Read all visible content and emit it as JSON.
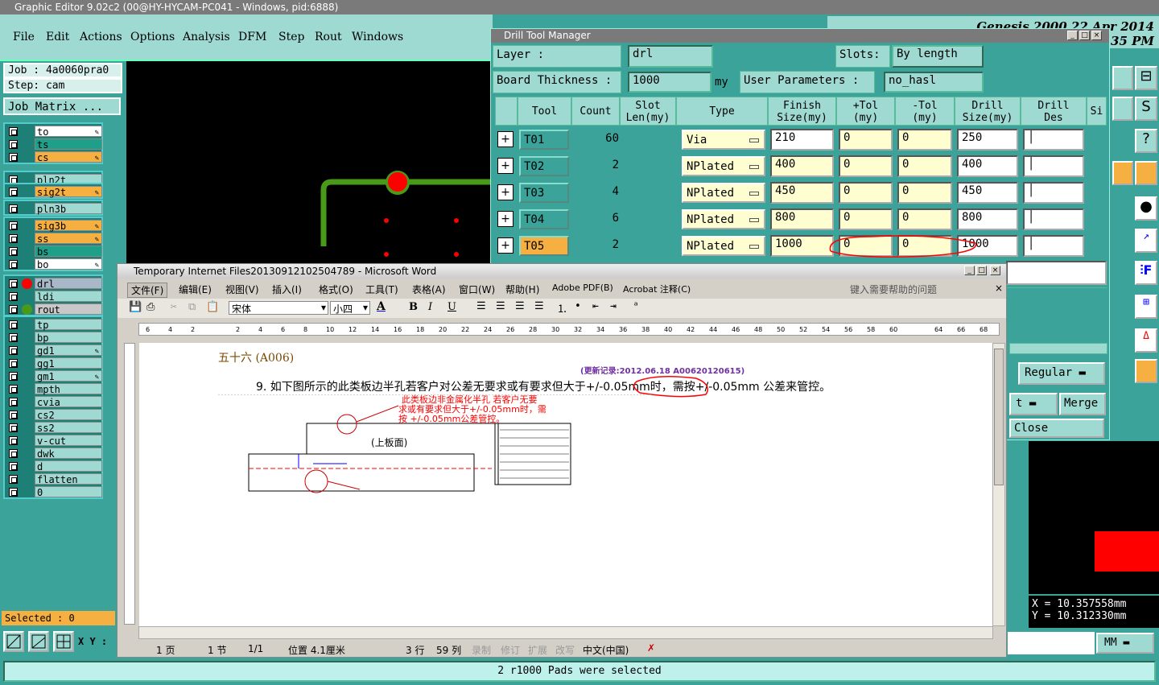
{
  "main_window": {
    "title": "Graphic Editor 9.02c2 (00@HY-HYCAM-PC041 - Windows, pid:6888)",
    "menu": [
      "File",
      "Edit",
      "Actions",
      "Options",
      "Analysis",
      "DFM",
      "Step",
      "Rout",
      "Windows"
    ],
    "right_title": "Genesis 2000 22 Apr 2014",
    "right_time": "35 PM"
  },
  "left_panel": {
    "job": "Job : 4a0060pra0",
    "step": "Step: cam",
    "job_matrix": "Job Matrix ...",
    "groups": [
      [
        {
          "n": "to",
          "c": "#ffffff",
          "m": "✎"
        },
        {
          "n": "ts",
          "c": "#1e9f8a",
          "m": ""
        },
        {
          "n": "cs",
          "c": "#f5b041",
          "m": "✎"
        }
      ],
      [
        {
          "n": "pln2t",
          "c": "#9ed9d2",
          "m": ""
        }
      ],
      [
        {
          "n": "sig2t",
          "c": "#f5b041",
          "m": "✎"
        }
      ],
      [
        {
          "n": "pln3b",
          "c": "#9ed9d2",
          "m": ""
        }
      ],
      [
        {
          "n": "sig3b",
          "c": "#f5b041",
          "m": "✎"
        },
        {
          "n": "ss",
          "c": "#f5b041",
          "m": "✎"
        },
        {
          "n": "bs",
          "c": "#1e9f8a",
          "m": ""
        },
        {
          "n": "bo",
          "c": "#ffffff",
          "m": "✎"
        }
      ],
      [
        {
          "n": "drl",
          "c": "#a8b8c8",
          "m": ""
        },
        {
          "n": "ldi",
          "c": "#9ed9d2",
          "m": ""
        },
        {
          "n": "rout",
          "c": "#c8c8c8",
          "m": ""
        }
      ],
      [
        {
          "n": "tp",
          "c": "#9ed9d2",
          "m": ""
        },
        {
          "n": "bp",
          "c": "#9ed9d2",
          "m": ""
        },
        {
          "n": "gd1",
          "c": "#9ed9d2",
          "m": "✎"
        },
        {
          "n": "gg1",
          "c": "#9ed9d2",
          "m": ""
        },
        {
          "n": "gm1",
          "c": "#9ed9d2",
          "m": "✎"
        },
        {
          "n": "mpth",
          "c": "#9ed9d2",
          "m": ""
        },
        {
          "n": "cvia",
          "c": "#9ed9d2",
          "m": ""
        },
        {
          "n": "cs2",
          "c": "#9ed9d2",
          "m": ""
        },
        {
          "n": "ss2",
          "c": "#9ed9d2",
          "m": ""
        },
        {
          "n": "v-cut",
          "c": "#9ed9d2",
          "m": ""
        },
        {
          "n": "dwk",
          "c": "#9ed9d2",
          "m": ""
        },
        {
          "n": "d",
          "c": "#9ed9d2",
          "m": ""
        },
        {
          "n": "flatten",
          "c": "#9ed9d2",
          "m": ""
        },
        {
          "n": "0",
          "c": "#9ed9d2",
          "m": ""
        }
      ]
    ],
    "selected": "Selected : 0",
    "xy_label": "X Y :"
  },
  "drill_tool_manager": {
    "title": "Drill Tool Manager",
    "layer_label": "Layer       :",
    "layer_value": "drl",
    "slots_label": "Slots:",
    "slots_value": "By length",
    "thickness_label": "Board Thickness  :",
    "thickness_value": "1000",
    "thickness_unit": "my",
    "user_params_label": "User Parameters :",
    "user_params_value": "no_hasl",
    "headers": [
      "Tool",
      "Count",
      "Slot\nLen(my)",
      "Type",
      "Finish\nSize(my)",
      "+Tol\n(my)",
      "-Tol\n(my)",
      "Drill\nSize(my)",
      "Drill\nDes",
      "Si"
    ],
    "rows": [
      {
        "tool": "T01",
        "count": "60",
        "type": "Via",
        "finish": "210",
        "ptol": "0",
        "ntol": "0",
        "drill": "250",
        "des": ""
      },
      {
        "tool": "T02",
        "count": "2",
        "type": "NPlated",
        "finish": "400",
        "ptol": "0",
        "ntol": "0",
        "drill": "400",
        "des": ""
      },
      {
        "tool": "T03",
        "count": "4",
        "type": "NPlated",
        "finish": "450",
        "ptol": "0",
        "ntol": "0",
        "drill": "450",
        "des": ""
      },
      {
        "tool": "T04",
        "count": "6",
        "type": "NPlated",
        "finish": "800",
        "ptol": "0",
        "ntol": "0",
        "drill": "800",
        "des": ""
      },
      {
        "tool": "T05",
        "count": "2",
        "type": "NPlated",
        "finish": "1000",
        "ptol": "0",
        "ntol": "0",
        "drill": "1000",
        "des": ""
      }
    ],
    "regular": "Regular",
    "merge": "Merge",
    "close": "Close"
  },
  "word": {
    "title": "Temporary Internet Files20130912102504789 - Microsoft Word",
    "menu": [
      "文件(F)",
      "编辑(E)",
      "视图(V)",
      "插入(I)",
      "格式(O)",
      "工具(T)",
      "表格(A)",
      "窗口(W)",
      "帮助(H)",
      "Adobe PDF(B)",
      "Acrobat 注释(C)"
    ],
    "help_placeholder": "键入需要帮助的问题",
    "font": "宋体",
    "size": "小四",
    "heading": "五十六  (A006)",
    "update": "(更新记录:2012.06.18   A00620120615)",
    "para": "9.  如下图所示的此类板边半孔若客户对公差无要求或有要求但大于+/-0.05mm时，需按+/-0.05mm 公差来管控。",
    "fig_note1": "此类板边非金属化半孔  若客户无要",
    "fig_note2": "求或有要求但大于+/-0.05mm时，需",
    "fig_note3": "按 +/-0.05mm公差管控。",
    "fig_label": "(上板面)",
    "status": [
      "1 页",
      "1 节",
      "1/1",
      "位置 4.1厘米",
      "3 行",
      "59 列",
      "录制",
      "修订",
      "扩展",
      "改写",
      "中文(中国)"
    ],
    "ruler": [
      "6",
      "4",
      "2",
      "",
      "2",
      "4",
      "6",
      "8",
      "10",
      "12",
      "14",
      "16",
      "18",
      "20",
      "22",
      "24",
      "26",
      "28",
      "30",
      "32",
      "34",
      "36",
      "38",
      "40",
      "42",
      "44",
      "46",
      "48",
      "50",
      "52",
      "54",
      "56",
      "58",
      "60",
      "",
      "64",
      "66",
      "68"
    ]
  },
  "coords": {
    "x": "X  =  10.357558mm",
    "y": "Y  =  10.312330mm",
    "unit": "MM"
  },
  "status_msg": "2 r1000 Pads were selected"
}
